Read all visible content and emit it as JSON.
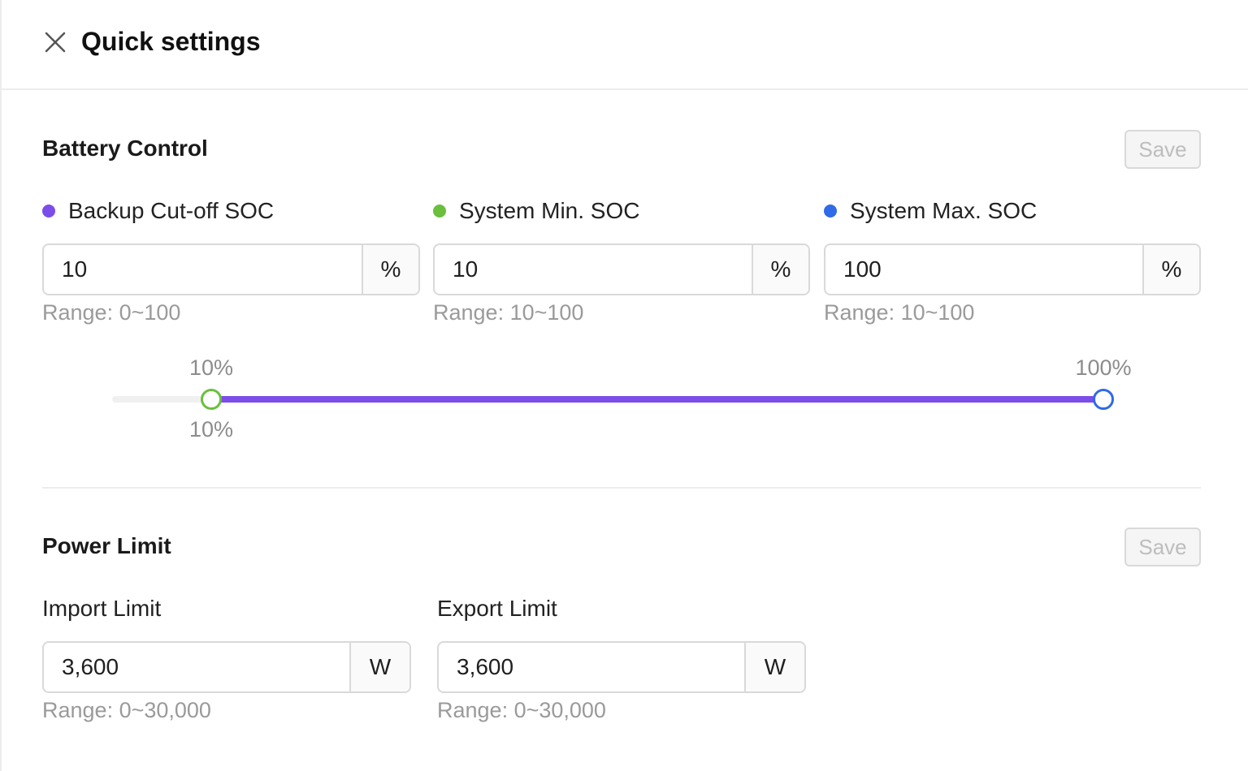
{
  "header": {
    "title": "Quick settings",
    "close_icon": "close-icon"
  },
  "battery_control": {
    "title": "Battery Control",
    "save_label": "Save",
    "fields": [
      {
        "label": "Backup Cut-off SOC",
        "value": "10",
        "unit": "%",
        "range": "Range: 0~100",
        "dot_color": "#7c4de8"
      },
      {
        "label": "System Min. SOC",
        "value": "10",
        "unit": "%",
        "range": "Range: 10~100",
        "dot_color": "#6abf3c"
      },
      {
        "label": "System Max. SOC",
        "value": "100",
        "unit": "%",
        "range": "Range: 10~100",
        "dot_color": "#2f6ae8"
      }
    ],
    "slider": {
      "min_label": "10%",
      "max_label": "100%",
      "backup_label": "10%",
      "min_value": 10,
      "max_value": 100,
      "backup_value": 10,
      "track_color": "#7c4de8",
      "rail_color": "#f0f0f0",
      "min_handle_color": "#6abf3c",
      "max_handle_color": "#2f6ae8"
    }
  },
  "power_limit": {
    "title": "Power Limit",
    "save_label": "Save",
    "fields": [
      {
        "label": "Import Limit",
        "value": "3,600",
        "unit": "W",
        "range": "Range: 0~30,000"
      },
      {
        "label": "Export Limit",
        "value": "3,600",
        "unit": "W",
        "range": "Range: 0~30,000"
      }
    ]
  }
}
